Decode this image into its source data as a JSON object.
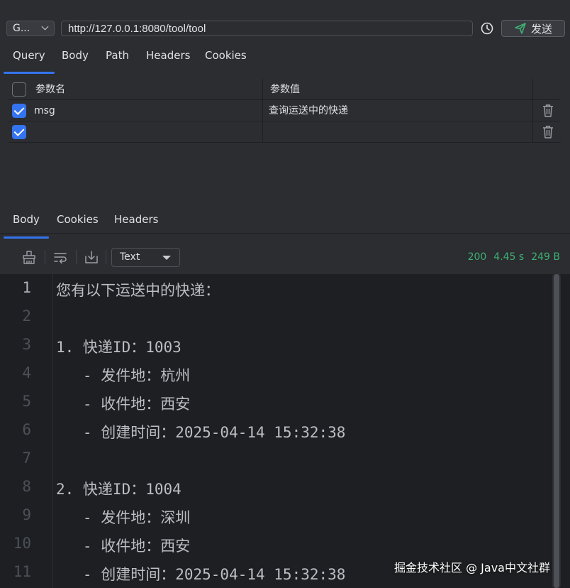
{
  "request": {
    "method": "G...",
    "url": "http://127.0.0.1:8080/tool/tool",
    "send_label": "发送"
  },
  "request_tabs": [
    {
      "label": "Query",
      "active": true
    },
    {
      "label": "Body"
    },
    {
      "label": "Path"
    },
    {
      "label": "Headers"
    },
    {
      "label": "Cookies"
    }
  ],
  "params": {
    "header_name": "参数名",
    "header_value": "参数值",
    "rows": [
      {
        "checked": true,
        "name": "msg",
        "value": "查询运送中的快递"
      },
      {
        "checked": true,
        "name": "",
        "value": ""
      }
    ]
  },
  "response_tabs": [
    {
      "label": "Body",
      "active": true
    },
    {
      "label": "Cookies"
    },
    {
      "label": "Headers"
    }
  ],
  "response_toolbar": {
    "format": "Text",
    "status": "200",
    "time": "4.45 s",
    "size": "249 B"
  },
  "response_body": {
    "lines": [
      "您有以下运送中的快递：",
      "",
      "1. 快递ID：1003",
      "   - 发件地：杭州",
      "   - 收件地：西安",
      "   - 创建时间：2025-04-14 15:32:38",
      "",
      "2. 快递ID：1004",
      "   - 发件地：深圳",
      "   - 收件地：西安",
      "   - 创建时间：2025-04-14 15:32:38"
    ],
    "line_numbers": [
      "1",
      "2",
      "3",
      "4",
      "5",
      "6",
      "7",
      "8",
      "9",
      "10",
      "11"
    ]
  },
  "watermark": "掘金技术社区 @ Java中文社群",
  "colors": {
    "accent": "#3574f0",
    "status_ok": "#3fb074",
    "background": "#2b2d30",
    "editor_bg": "#1e1f22"
  },
  "icons": [
    "chevron-down-icon",
    "history-icon",
    "send-icon",
    "trash-icon",
    "clear-icon",
    "wrap-icon",
    "download-icon"
  ]
}
